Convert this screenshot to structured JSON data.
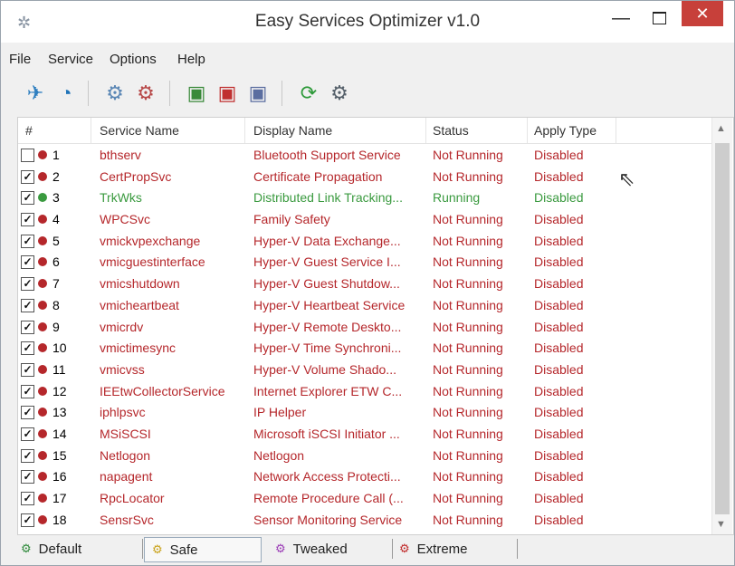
{
  "window": {
    "title": "Easy Services Optimizer v1.0"
  },
  "titlebar": {
    "minimize": "—",
    "close": "✕"
  },
  "menu": [
    "File",
    "Service",
    "Options",
    "Help"
  ],
  "columns": [
    "#",
    "Service Name",
    "Display Name",
    "Status",
    "Apply Type"
  ],
  "colors": {
    "stopped": "#b5272b",
    "running": "#3a9a3f"
  },
  "rows": [
    {
      "checked": false,
      "num": "1",
      "name": "bthserv",
      "display": "Bluetooth Support Service",
      "status": "Not Running",
      "apply": "Disabled",
      "state": "stopped"
    },
    {
      "checked": true,
      "num": "2",
      "name": "CertPropSvc",
      "display": "Certificate Propagation",
      "status": "Not Running",
      "apply": "Disabled",
      "state": "stopped"
    },
    {
      "checked": true,
      "num": "3",
      "name": "TrkWks",
      "display": "Distributed Link Tracking...",
      "status": "Running",
      "apply": "Disabled",
      "state": "running"
    },
    {
      "checked": true,
      "num": "4",
      "name": "WPCSvc",
      "display": "Family Safety",
      "status": "Not Running",
      "apply": "Disabled",
      "state": "stopped"
    },
    {
      "checked": true,
      "num": "5",
      "name": "vmickvpexchange",
      "display": "Hyper-V Data Exchange...",
      "status": "Not Running",
      "apply": "Disabled",
      "state": "stopped"
    },
    {
      "checked": true,
      "num": "6",
      "name": "vmicguestinterface",
      "display": "Hyper-V Guest Service I...",
      "status": "Not Running",
      "apply": "Disabled",
      "state": "stopped"
    },
    {
      "checked": true,
      "num": "7",
      "name": "vmicshutdown",
      "display": "Hyper-V Guest Shutdow...",
      "status": "Not Running",
      "apply": "Disabled",
      "state": "stopped"
    },
    {
      "checked": true,
      "num": "8",
      "name": "vmicheartbeat",
      "display": "Hyper-V Heartbeat Service",
      "status": "Not Running",
      "apply": "Disabled",
      "state": "stopped"
    },
    {
      "checked": true,
      "num": "9",
      "name": "vmicrdv",
      "display": "Hyper-V Remote Deskto...",
      "status": "Not Running",
      "apply": "Disabled",
      "state": "stopped"
    },
    {
      "checked": true,
      "num": "10",
      "name": "vmictimesync",
      "display": "Hyper-V Time Synchroni...",
      "status": "Not Running",
      "apply": "Disabled",
      "state": "stopped"
    },
    {
      "checked": true,
      "num": "11",
      "name": "vmicvss",
      "display": "Hyper-V Volume Shado...",
      "status": "Not Running",
      "apply": "Disabled",
      "state": "stopped"
    },
    {
      "checked": true,
      "num": "12",
      "name": "IEEtwCollectorService",
      "display": "Internet Explorer ETW C...",
      "status": "Not Running",
      "apply": "Disabled",
      "state": "stopped"
    },
    {
      "checked": true,
      "num": "13",
      "name": "iphlpsvc",
      "display": "IP Helper",
      "status": "Not Running",
      "apply": "Disabled",
      "state": "stopped"
    },
    {
      "checked": true,
      "num": "14",
      "name": "MSiSCSI",
      "display": "Microsoft iSCSI Initiator ...",
      "status": "Not Running",
      "apply": "Disabled",
      "state": "stopped"
    },
    {
      "checked": true,
      "num": "15",
      "name": "Netlogon",
      "display": "Netlogon",
      "status": "Not Running",
      "apply": "Disabled",
      "state": "stopped"
    },
    {
      "checked": true,
      "num": "16",
      "name": "napagent",
      "display": "Network Access Protecti...",
      "status": "Not Running",
      "apply": "Disabled",
      "state": "stopped"
    },
    {
      "checked": true,
      "num": "17",
      "name": "RpcLocator",
      "display": "Remote Procedure Call (...",
      "status": "Not Running",
      "apply": "Disabled",
      "state": "stopped"
    },
    {
      "checked": true,
      "num": "18",
      "name": "SensrSvc",
      "display": "Sensor Monitoring Service",
      "status": "Not Running",
      "apply": "Disabled",
      "state": "stopped"
    }
  ],
  "tabs": [
    "Default",
    "Safe",
    "Tweaked",
    "Extreme"
  ],
  "active_tab": "Safe"
}
